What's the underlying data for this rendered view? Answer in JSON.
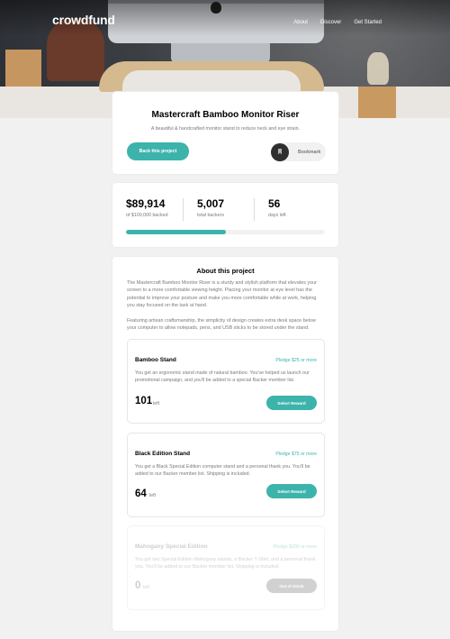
{
  "header": {
    "logo": "crowdfund",
    "nav": [
      "About",
      "Discover",
      "Get Started"
    ]
  },
  "intro": {
    "title": "Mastercraft Bamboo Monitor Riser",
    "description": "A beautiful & handcrafted monitor stand to reduce neck and eye strain.",
    "back_button": "Back this project",
    "bookmark_label": "Bookmark"
  },
  "stats": {
    "backed_amount": "$89,914",
    "backed_label": "of $100,000 backed",
    "backers": "5,007",
    "backers_label": "total backers",
    "days": "56",
    "days_label": "days left",
    "progress_fraction": 0.5
  },
  "about": {
    "title": "About this project",
    "p1": "The Mastercraft Bamboo Monitor Riser is a sturdy and stylish platform that elevates your screen to a more comfortable viewing height. Placing your monitor at eye level has the potential to improve your posture and make you more comfortable while at work, helping you stay focused on the task at hand.",
    "p2": "Featuring artisan craftsmanship, the simplicity of design creates extra desk space below your computer to allow notepads, pens, and USB sticks to be stored under the stand."
  },
  "pledges": [
    {
      "title": "Bamboo Stand",
      "min": "Pledge $25 or more",
      "text": "You get an ergonomic stand made of natural bamboo. You've helped us launch our promotional campaign, and you'll be added to a special Backer member list.",
      "count": "101",
      "left_label": "left",
      "button": "Select Reward"
    },
    {
      "title": "Black Edition Stand",
      "min": "Pledge $75 or more",
      "text": "You get a Black Special Edition computer stand and a personal thank you. You'll be added to our Backer member list. Shipping is included.",
      "count": "64",
      "left_label": "left",
      "button": "Select Reward"
    },
    {
      "title": "Mahogany Special Edition",
      "min": "Pledge $200 or more",
      "text": "You get two Special Edition Mahogany stands, a Backer T-Shirt, and a personal thank you. You'll be added to our Backer member list. Shipping is included.",
      "count": "0",
      "left_label": "left",
      "button": "Out of Stock"
    }
  ],
  "colors": {
    "accent": "#3cb3ab",
    "accent_dark": "#147b74",
    "background": "#f1f1f1"
  }
}
